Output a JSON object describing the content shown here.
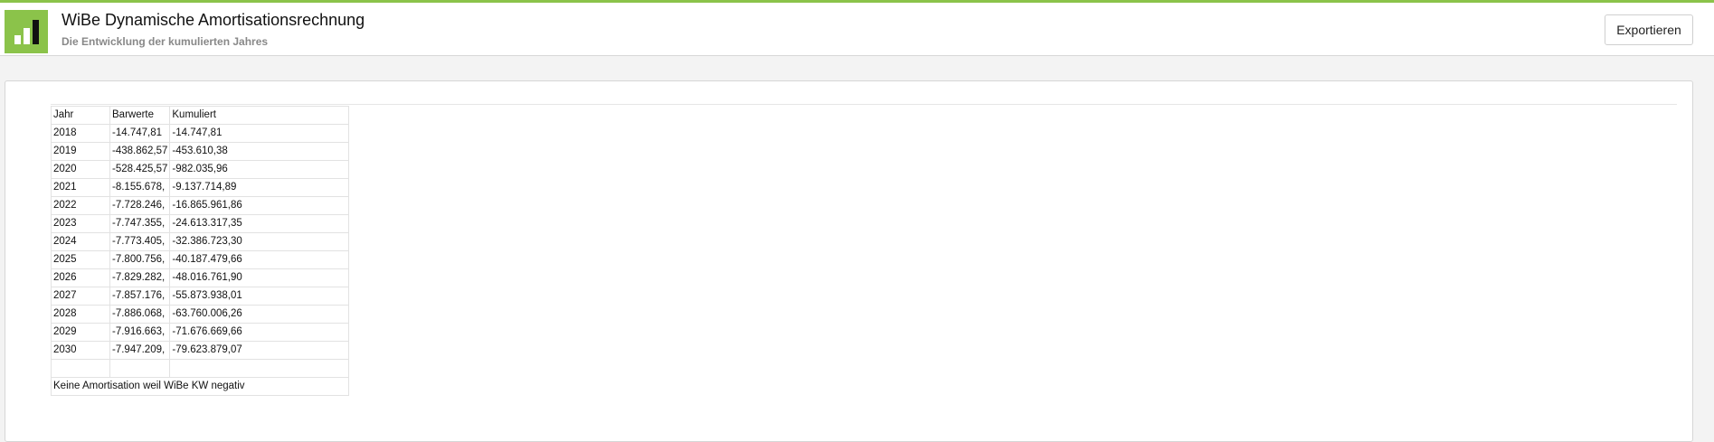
{
  "header": {
    "title": "WiBe Dynamische Amortisationsrechnung",
    "subtitle": "Die Entwicklung der kumulierten Jahres",
    "export_label": "Exportieren",
    "accent_color": "#8bc34a",
    "logo_icon": "bar-chart-icon"
  },
  "table": {
    "columns": [
      "Jahr",
      "Barwerte",
      "Kumuliert"
    ],
    "rows": [
      [
        "2018",
        "-14.747,81",
        "-14.747,81"
      ],
      [
        "2019",
        "-438.862,57",
        "-453.610,38"
      ],
      [
        "2020",
        "-528.425,57",
        "-982.035,96"
      ],
      [
        "2021",
        "-8.155.678,",
        "-9.137.714,89"
      ],
      [
        "2022",
        "-7.728.246,",
        "-16.865.961,86"
      ],
      [
        "2023",
        "-7.747.355,",
        "-24.613.317,35"
      ],
      [
        "2024",
        "-7.773.405,",
        "-32.386.723,30"
      ],
      [
        "2025",
        "-7.800.756,",
        "-40.187.479,66"
      ],
      [
        "2026",
        "-7.829.282,",
        "-48.016.761,90"
      ],
      [
        "2027",
        "-7.857.176,",
        "-55.873.938,01"
      ],
      [
        "2028",
        "-7.886.068,",
        "-63.760.006,26"
      ],
      [
        "2029",
        "-7.916.663,",
        "-71.676.669,66"
      ],
      [
        "2030",
        "-7.947.209,",
        "-79.623.879,07"
      ]
    ],
    "note": "Keine Amortisation weil WiBe KW negativ"
  }
}
